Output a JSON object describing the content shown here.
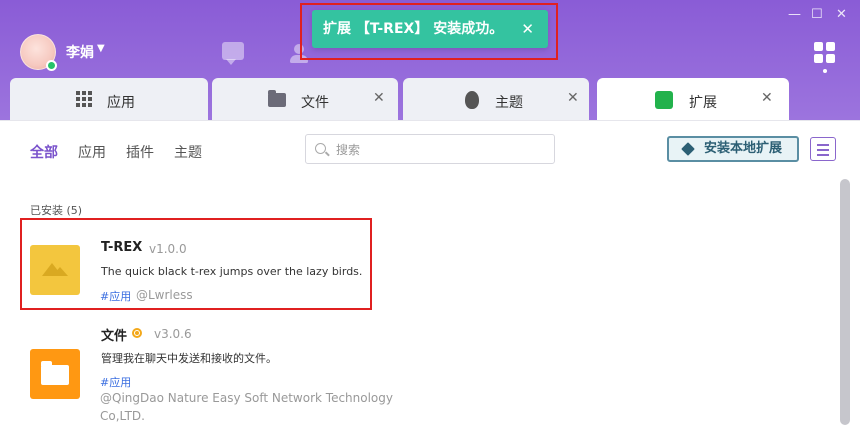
{
  "user": {
    "name": "李娟"
  },
  "toast": {
    "message": "扩展 【T-REX】 安装成功。",
    "close": "✕"
  },
  "window_controls": {
    "minimize": "—",
    "maximize": "☐",
    "close": "✕"
  },
  "tabs": [
    {
      "label": "应用",
      "close": ""
    },
    {
      "label": "文件",
      "close": "✕"
    },
    {
      "label": "主题",
      "close": "✕"
    },
    {
      "label": "扩展",
      "close": "✕"
    }
  ],
  "filters": [
    "全部",
    "应用",
    "插件",
    "主题"
  ],
  "search": {
    "placeholder": "搜索",
    "value": ""
  },
  "install_local_label": "安装本地扩展",
  "installed_label": "已安装 (5)",
  "extensions": [
    {
      "name": "T-REX",
      "version": "v1.0.0",
      "description": "The quick black t-rex jumps over the lazy birds.",
      "tag": "#应用",
      "author": "@Lwrless"
    },
    {
      "name": "文件",
      "version": "v3.0.6",
      "description": "管理我在聊天中发送和接收的文件。",
      "tag": "#应用",
      "author_line1": "@QingDao Nature Easy Soft Network Technology",
      "author_line2": "Co,LTD."
    }
  ],
  "colors": {
    "accent": "#7a53cc",
    "toast": "#34c3a0",
    "titlebar": "#8a5cd6",
    "trex_icon": "#f3c63e",
    "file_icon": "#ff9812"
  }
}
